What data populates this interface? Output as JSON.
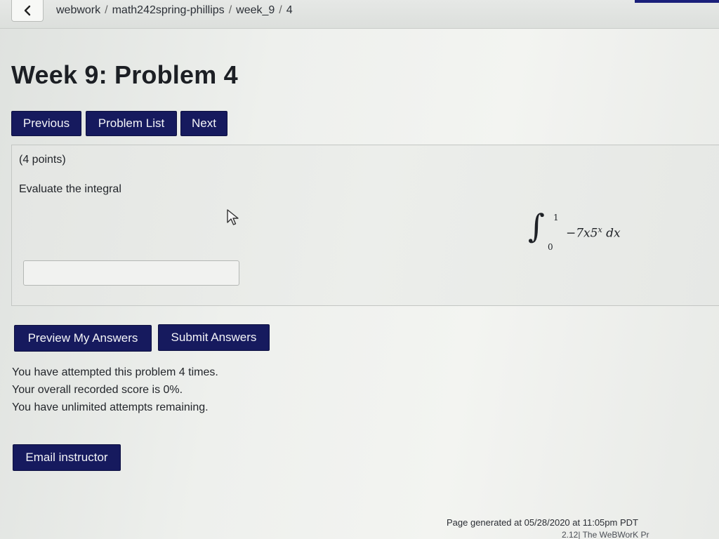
{
  "nav": {
    "breadcrumb": [
      "webwork",
      "math242spring-phillips",
      "week_9",
      "4"
    ],
    "accent_color": "#1a1f7a"
  },
  "page": {
    "title": "Week 9: Problem 4"
  },
  "buttons": {
    "previous": "Previous",
    "problem_list": "Problem List",
    "next": "Next",
    "preview": "Preview My Answers",
    "submit": "Submit Answers",
    "email": "Email instructor",
    "color": "#161a5e"
  },
  "problem": {
    "points": "(4 points)",
    "prompt": "Evaluate the integral",
    "integral": {
      "sign": "∫",
      "upper": "1",
      "lower": "0",
      "coefficient": "−7x5",
      "exponent": "x",
      "differential": "dx"
    },
    "answer_value": "",
    "answer_placeholder": ""
  },
  "status": {
    "attempts": "You have attempted this problem 4 times.",
    "score": "Your overall recorded score is 0%.",
    "remaining": "You have unlimited attempts remaining."
  },
  "footer": {
    "generated": "Page generated at 05/28/2020 at 11:05pm PDT",
    "version": "2.12| The WeBWorK Pr"
  }
}
